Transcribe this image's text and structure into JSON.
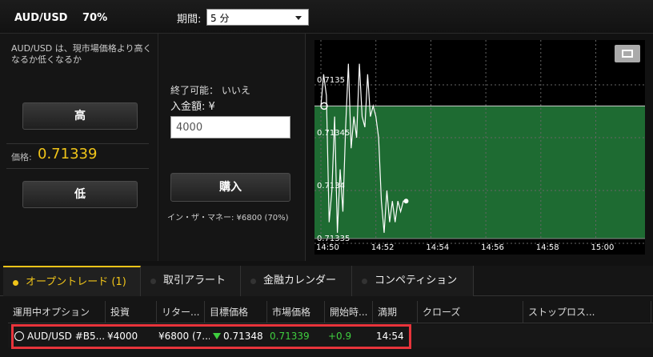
{
  "header": {
    "asset": "AUD/USD",
    "payout": "70%",
    "period_label": "期間:",
    "period_value": "5 分"
  },
  "left": {
    "description": "AUD/USD は、現市場価格より高くなるか低くなるか",
    "high_label": "高",
    "price_label": "価格:",
    "price_value": "0.71339",
    "low_label": "低"
  },
  "middle": {
    "expiry_text": "終了可能： いいえ",
    "deposit_text": "入金額: ¥",
    "amount_value": "4000",
    "buy_label": "購入",
    "itm_text": "イン・ザ・マネー: ¥6800 (70%)"
  },
  "chart_data": {
    "type": "line",
    "x_ticks": [
      "14:50",
      "14:52",
      "14:54",
      "14:56",
      "14:58",
      "15:00"
    ],
    "y_ticks": [
      "0.7135",
      "0.71345",
      "0.7134",
      "0.71335"
    ],
    "ylim": [
      0.71335,
      0.7135
    ],
    "target_price": 0.71348,
    "series": [
      {
        "x": [
          0,
          0.1,
          0.2,
          0.3,
          0.4,
          0.5,
          0.6,
          0.7,
          0.8,
          0.9,
          1.0,
          1.1,
          1.2,
          1.3,
          1.4,
          1.5,
          1.6,
          1.7,
          1.8,
          1.9,
          2.0,
          2.1,
          2.2,
          2.3,
          2.4,
          2.5,
          2.6,
          2.7,
          2.8,
          2.9,
          3.0,
          3.1
        ],
        "values": [
          0.71348,
          0.71351,
          0.71349,
          0.71337,
          0.7134,
          0.71347,
          0.71336,
          0.71342,
          0.71338,
          0.71346,
          0.71352,
          0.71344,
          0.71347,
          0.71345,
          0.71352,
          0.71347,
          0.71346,
          0.71351,
          0.71347,
          0.71348,
          0.71347,
          0.71345,
          0.71339,
          0.71336,
          0.7134,
          0.71337,
          0.71339,
          0.71337,
          0.71339,
          0.71338,
          0.71339,
          0.71339
        ]
      }
    ],
    "grid": true,
    "colors": {
      "zone": "#1e6b32",
      "line": "#ffffff",
      "target": "#cccccc"
    }
  },
  "tabs": [
    {
      "label": "オープントレード (1)",
      "active": true
    },
    {
      "label": "取引アラート",
      "active": false
    },
    {
      "label": "金融カレンダー",
      "active": false
    },
    {
      "label": "コンペティション",
      "active": false
    }
  ],
  "table": {
    "headers": [
      "運用中オプション",
      "投資",
      "リター...",
      "目標価格",
      "市場価格",
      "開始時...",
      "満期",
      "クローズ",
      "ストップロス..."
    ],
    "row": {
      "option": "AUD/USD #B5...",
      "invest": "¥4000",
      "return": "¥6800 (7...",
      "target": "0.71348",
      "market": "0.71339",
      "start": "+0.9",
      "expiry": "14:54"
    }
  }
}
